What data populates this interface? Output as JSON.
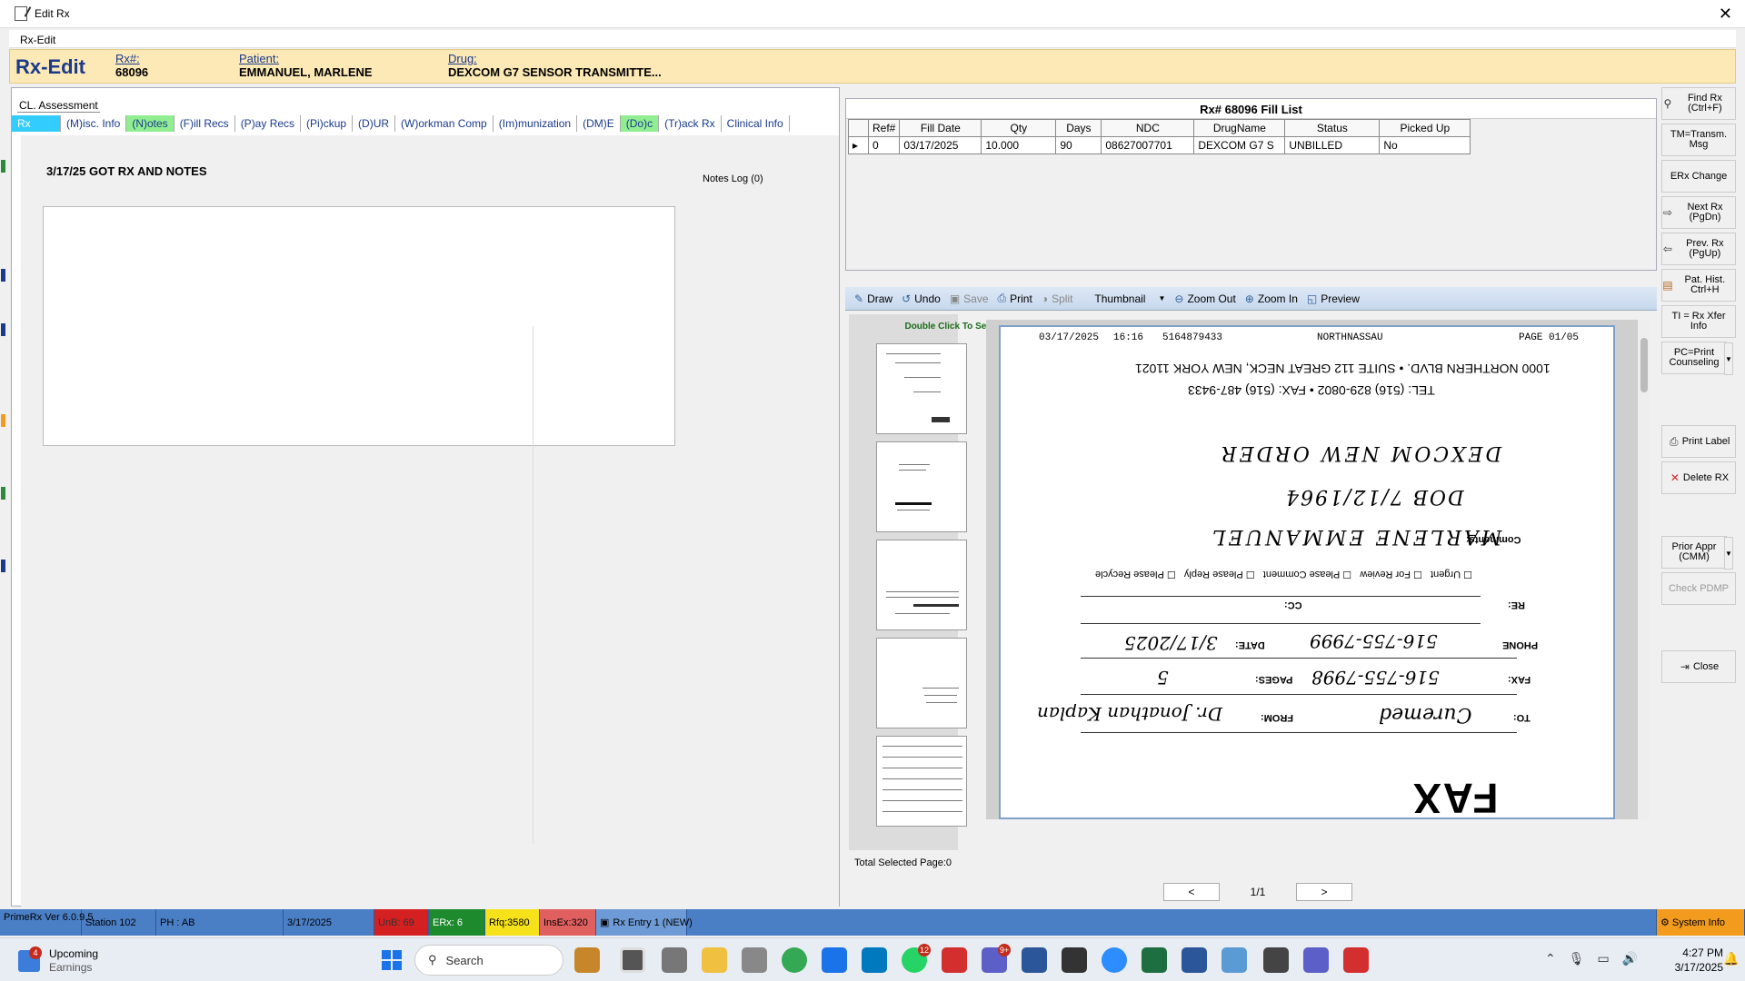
{
  "window": {
    "title": "Edit Rx",
    "menu": "Rx-Edit"
  },
  "header": {
    "title": "Rx-Edit",
    "rxno_label": "Rx#:",
    "rxno": "68096",
    "patient_label": "Patient:",
    "patient": "EMMANUEL, MARLENE",
    "drug_label": "Drug:",
    "drug": "DEXCOM G7 SENSOR TRANSMITTE..."
  },
  "left": {
    "cl_assessment": "CL. Assessment",
    "tabs": [
      "Rx",
      "(M)isc. Info",
      "(N)otes",
      "(F)ill Recs",
      "(P)ay Recs",
      "(Pi)ckup",
      "(D)UR",
      "(W)orkman Comp",
      "(Im)munization",
      "(DM)E",
      "(Do)c",
      "(Tr)ack Rx",
      "Clinical Info"
    ],
    "note_text": "3/17/25 GOT RX AND NOTES",
    "notes_log": "Notes Log (0)"
  },
  "fill_list": {
    "title": "Rx# 68096 Fill List",
    "headers": [
      "Ref#",
      "Fill Date",
      "Qty",
      "Days",
      "NDC",
      "DrugName",
      "Status",
      "Picked Up"
    ],
    "rows": [
      [
        "0",
        "03/17/2025",
        "10.000",
        "90",
        "08627007701",
        "DEXCOM G7 S",
        "UNBILLED",
        "No"
      ]
    ]
  },
  "side_buttons": [
    {
      "label": "Find Rx (Ctrl+F)",
      "icon": "binoculars-icon"
    },
    {
      "label": "TM=Transm. Msg",
      "icon": ""
    },
    {
      "label": "ERx Change",
      "icon": ""
    },
    {
      "label": "Next Rx (PgDn)",
      "icon": "arrow-right-icon"
    },
    {
      "label": "Prev. Rx (PgUp)",
      "icon": "arrow-left-icon"
    },
    {
      "label": "Pat. Hist. Ctrl+H",
      "icon": "history-icon"
    },
    {
      "label": "TI = Rx Xfer Info",
      "icon": ""
    },
    {
      "label": "PC=Print Counseling",
      "icon": ""
    },
    {
      "label": "Print Label",
      "icon": "printer-icon"
    },
    {
      "label": "Delete RX",
      "icon": "delete-icon"
    },
    {
      "label": "Prior Appr (CMM)",
      "icon": ""
    },
    {
      "label": "Check PDMP",
      "icon": ""
    },
    {
      "label": "Close",
      "icon": "exit-icon"
    }
  ],
  "viewer": {
    "tools": [
      "Draw",
      "Undo",
      "Save",
      "Print",
      "Split",
      "Thumbnail",
      "Zoom Out",
      "Zoom In",
      "Preview"
    ],
    "thumb_hint": "Double  Click To Select",
    "fax": {
      "date": "03/17/2025",
      "time": "16:16",
      "number": "5164879433",
      "sender": "NORTHNASSAU",
      "page": "PAGE  01/05",
      "address": "1000 NORTHERN BLVD. • SUITE 112  GREAT NECK, NEW YORK 11021",
      "phone": "TEL: (516) 829-0802 • FAX: (516) 487-9433",
      "line1": "DEXCOM NEW ORDER",
      "line2": "DOB 7/12/1964",
      "comments_label": "Comments:",
      "comments": "MARLENE EMMANUEL",
      "checkboxes": [
        "Urgent",
        "For Review",
        "Please Comment",
        "Please Reply",
        "Please Recycle"
      ],
      "re_label": "RE:",
      "cc_label": "CC:",
      "phone_label": "PHONE",
      "phone_val": "516-755-7999",
      "date_label": "DATE:",
      "date_val": "3/17/2025",
      "fax_label": "FAX:",
      "fax_val": "516-755-7998",
      "pages_label": "PAGES:",
      "pages_val": "5",
      "to_label": "TO:",
      "to_val": "Curemed",
      "from_label": "FROM:",
      "from_val": "Dr. Jonathan Kaplan",
      "big": "FAX"
    },
    "total_selected": "Total Selected Page:0",
    "pager": {
      "prev": "<",
      "next": ">",
      "page": "1/1"
    }
  },
  "status": {
    "ver": "PrimeRx Ver 6.0.9.5",
    "station": "Station 102",
    "ph": "PH : AB",
    "date": "3/17/2025",
    "unb": "UnB: 69",
    "erx": "ERx: 6",
    "rfq": "Rfq:3580",
    "insex": "InsEx:320",
    "rx_entry": "Rx Entry 1 (NEW)",
    "system_info": "System Info"
  },
  "taskbar": {
    "weather_title": "Upcoming",
    "weather_sub": "Earnings",
    "weather_badge": "4",
    "search": "Search",
    "time": "4:27 PM",
    "date": "3/17/2025",
    "badge_whatsapp": "12",
    "badge_teams": "9+"
  }
}
